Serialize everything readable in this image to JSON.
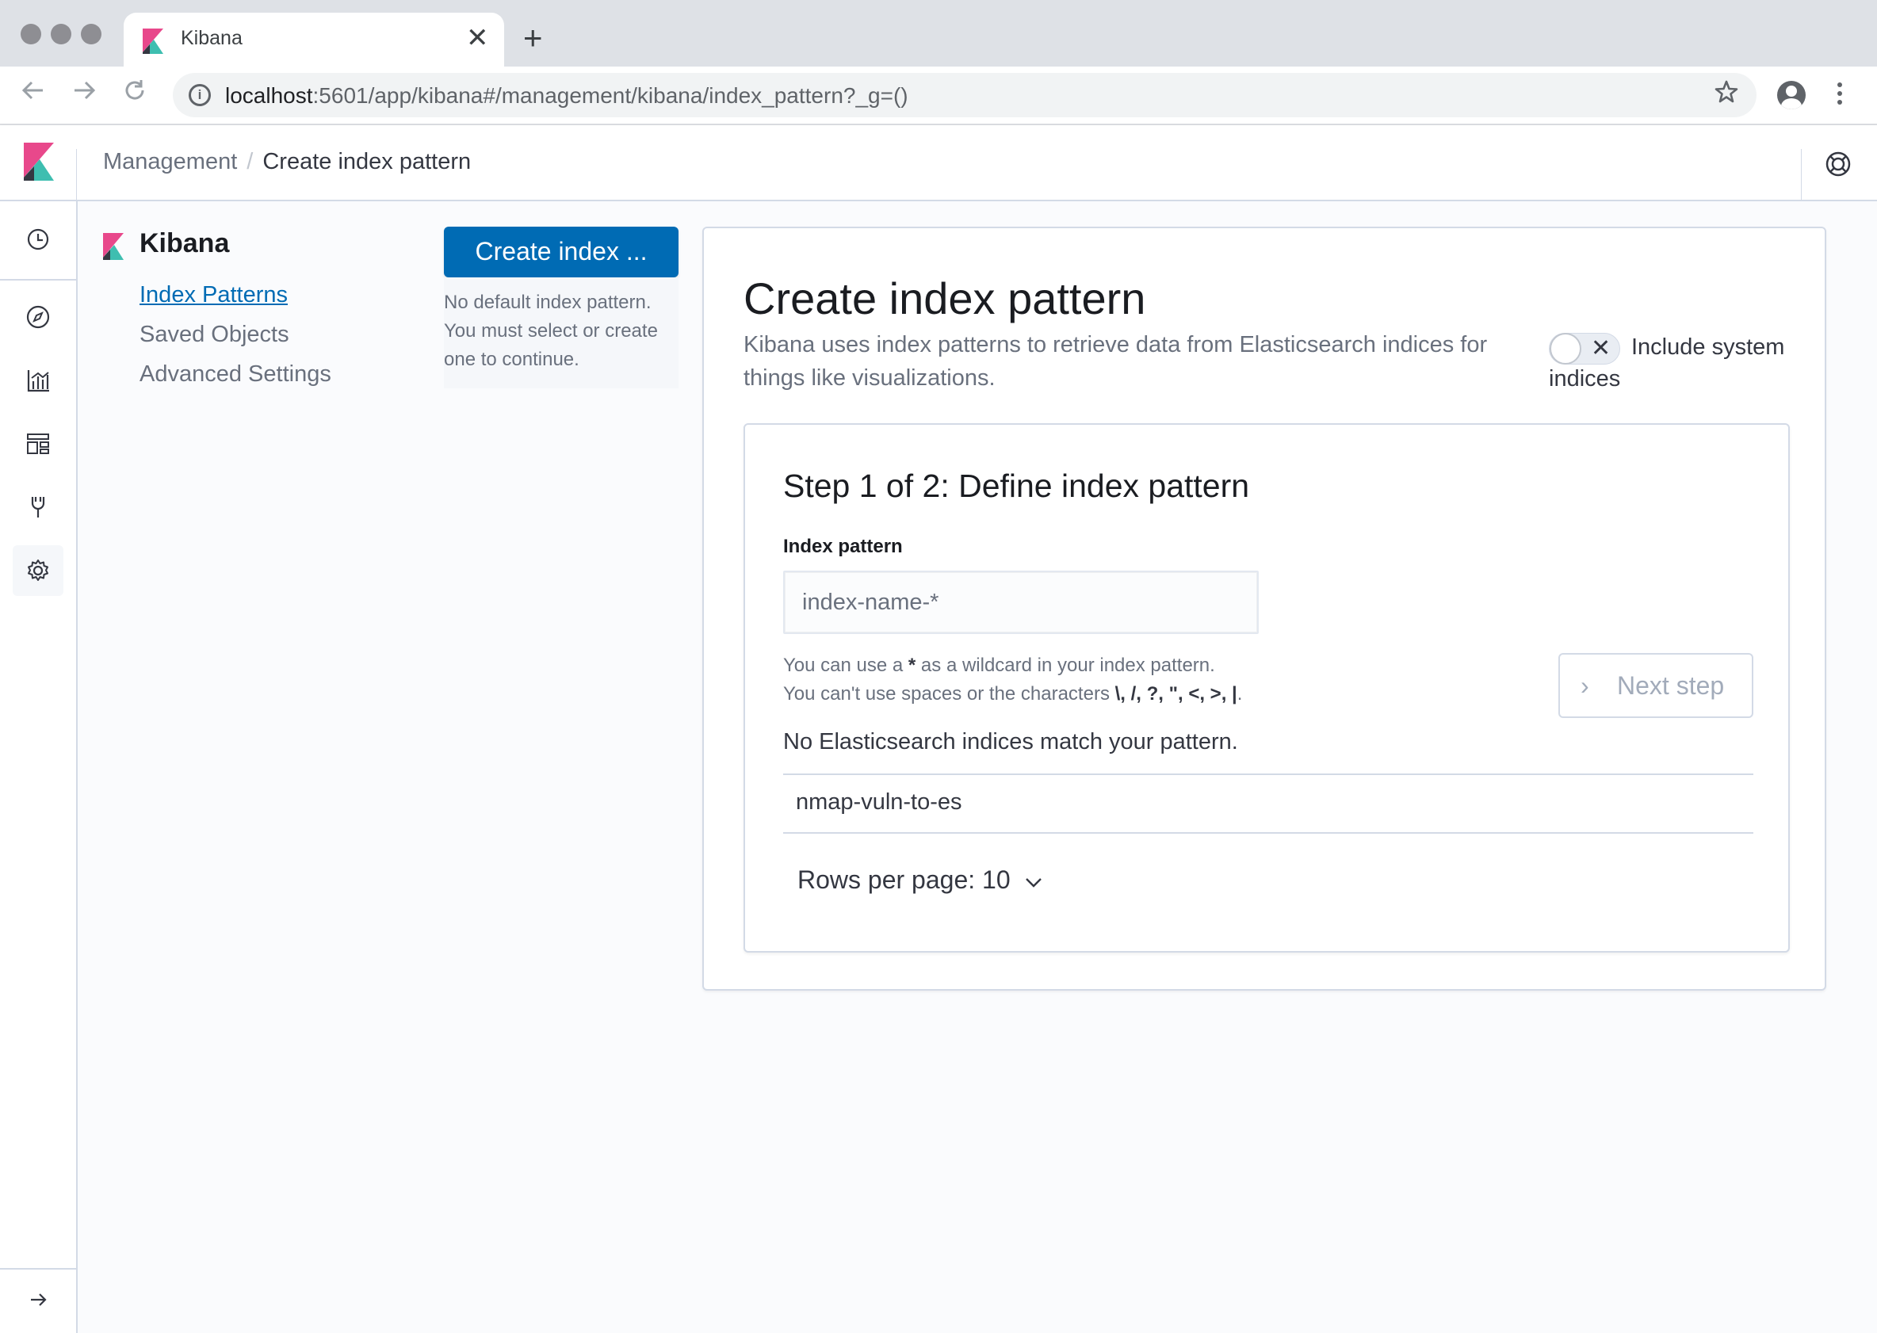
{
  "browser": {
    "tab_title": "Kibana",
    "tab_close": "✕",
    "new_tab": "+",
    "url_host": "localhost",
    "url_path": ":5601/app/kibana#/management/kibana/index_pattern?_g=()",
    "icons": [
      "back-icon",
      "forward-icon",
      "reload-icon",
      "info-icon",
      "star-icon",
      "profile-icon",
      "menu-icon"
    ]
  },
  "header": {
    "breadcrumb_parent": "Management",
    "breadcrumb_separator": "/",
    "breadcrumb_current": "Create index pattern"
  },
  "nav": {
    "icons": [
      "clock-icon",
      "compass-icon",
      "visualize-icon",
      "dashboard-icon",
      "devtools-icon",
      "gear-icon",
      "expand-arrow-icon"
    ],
    "active": "gear-icon"
  },
  "sidebar": {
    "title": "Kibana",
    "items": [
      {
        "label": "Index Patterns",
        "active": true
      },
      {
        "label": "Saved Objects",
        "active": false
      },
      {
        "label": "Advanced Settings",
        "active": false
      }
    ]
  },
  "create_button": {
    "label": "Create index ..."
  },
  "no_default": {
    "line1": "No default index pattern.",
    "line2": "You must select or create",
    "line3": "one to continue."
  },
  "panel": {
    "title": "Create index pattern",
    "description": "Kibana uses index patterns to retrieve data from Elasticsearch indices for things like visualizations.",
    "toggle_label": "Include system indices",
    "toggle_on": false,
    "toggle_icon": "✕"
  },
  "step": {
    "title": "Step 1 of 2: Define index pattern",
    "field_label": "Index pattern",
    "placeholder": "index-name-*",
    "value": "",
    "help_line1_pre": "You can use a ",
    "help_line1_star": "*",
    "help_line1_post": " as a wildcard in your index pattern.",
    "help_line2_pre": "You can't use spaces or the characters ",
    "help_line2_chars": "\\, /, ?, \", <, >, |",
    "help_line2_post": ".",
    "next_label": "Next step",
    "next_chevron": "›",
    "no_match": "No Elasticsearch indices match your pattern.",
    "indices": [
      "nmap-vuln-to-es"
    ],
    "rows_per_page": "Rows per page: 10"
  },
  "colors": {
    "primary": "#006bb4",
    "text": "#343741",
    "subdued": "#69707d",
    "border": "#d3dae6",
    "kibana_pink": "#e8488b",
    "kibana_teal": "#3ebeb0"
  }
}
